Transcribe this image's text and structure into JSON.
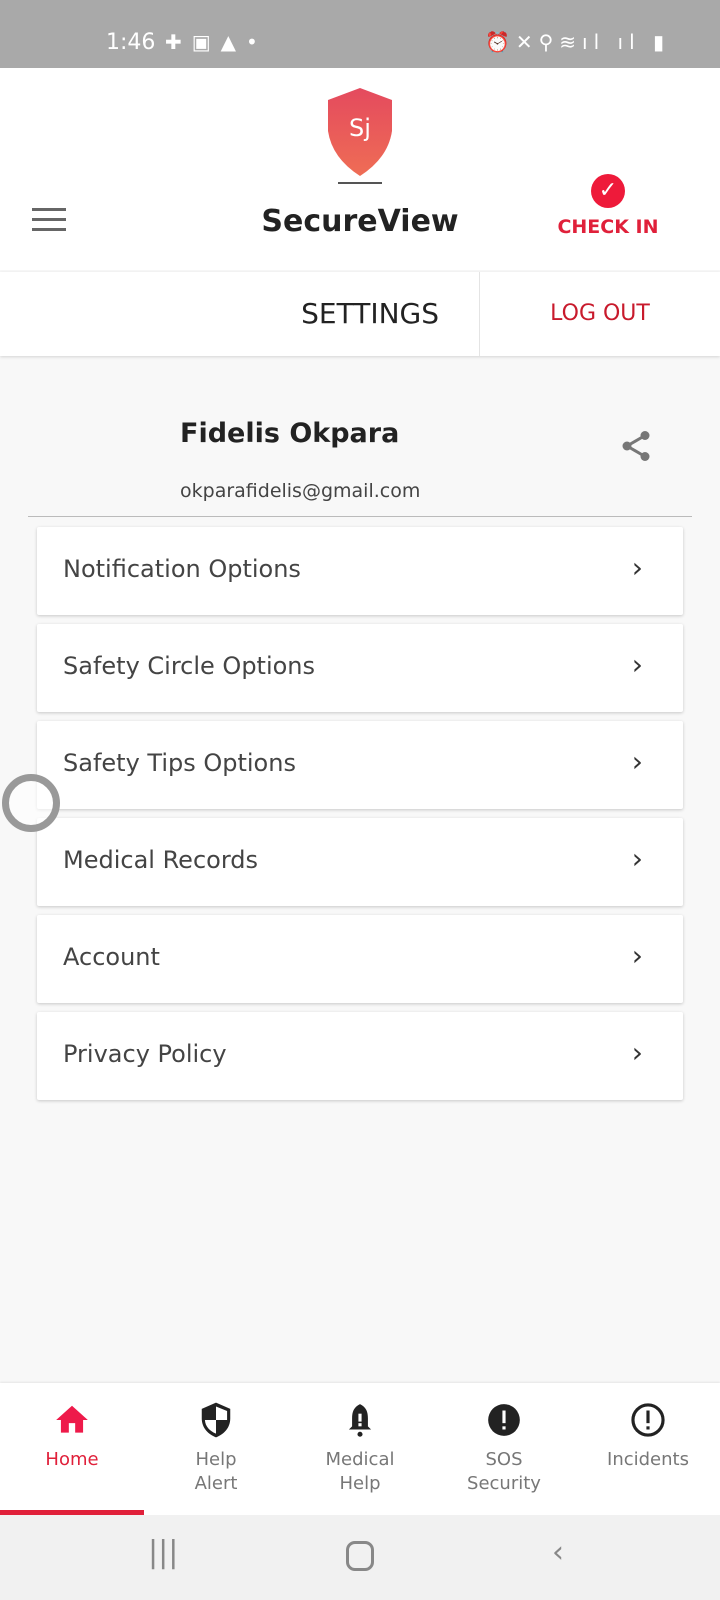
{
  "status_bar": {
    "time": "1:46",
    "left_icons": [
      "shield-plus-icon",
      "image-icon",
      "warning-icon",
      "dot-icon"
    ],
    "right_icons": [
      "alarm-icon",
      "vibrate-icon",
      "location-icon",
      "wifi-icon",
      "signal-icon",
      "signal-icon",
      "battery-icon"
    ]
  },
  "header": {
    "app_title": "SecureView",
    "check_in_label": "CHECK IN",
    "accent": "#e0203a"
  },
  "tabs": {
    "settings": "SETTINGS",
    "logout": "LOG OUT"
  },
  "profile": {
    "name": "Fidelis Okpara",
    "email": "okparafidelis@gmail.com"
  },
  "settings_items": [
    {
      "label": "Notification Options"
    },
    {
      "label": "Safety Circle Options"
    },
    {
      "label": "Safety Tips Options"
    },
    {
      "label": "Medical Records"
    },
    {
      "label": "Account"
    },
    {
      "label": "Privacy Policy"
    }
  ],
  "bottom_nav": [
    {
      "label": "Home",
      "icon": "home-icon",
      "active": true
    },
    {
      "label": "Help\nAlert",
      "icon": "shield-icon"
    },
    {
      "label": "Medical\nHelp",
      "icon": "bell-icon"
    },
    {
      "label": "SOS\nSecurity",
      "icon": "alert-circle-icon"
    },
    {
      "label": "Incidents",
      "icon": "alert-circle-outline-icon"
    }
  ]
}
